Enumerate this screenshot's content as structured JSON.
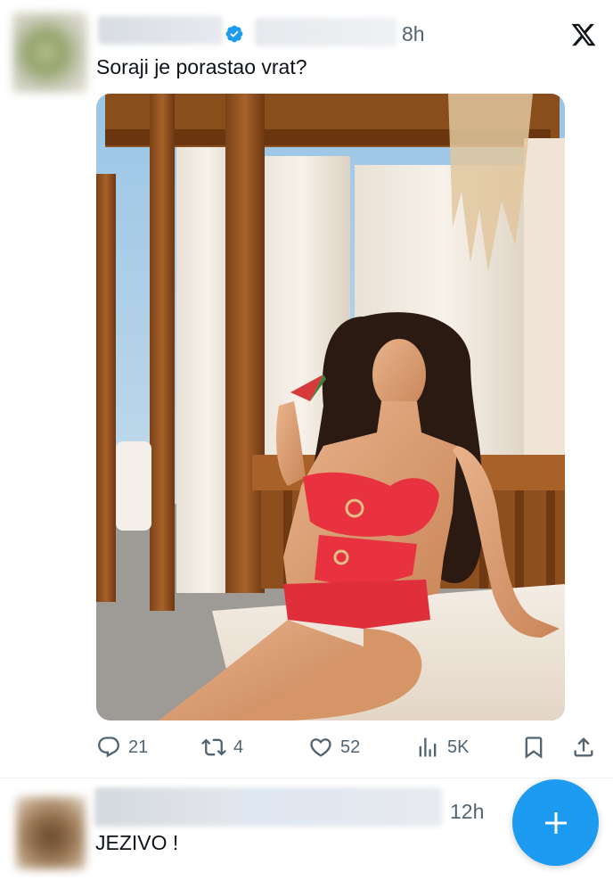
{
  "tweets": [
    {
      "time": "8h",
      "text": "Soraji je porastao vrat?",
      "stats": {
        "replies": "21",
        "retweets": "4",
        "likes": "52",
        "views": "5K"
      }
    },
    {
      "time": "12h",
      "text": "JEZIVO !"
    }
  ],
  "colors": {
    "accent": "#1d9bf0",
    "text": "#0f1419",
    "secondary": "#536471",
    "divider": "#eff3f4"
  },
  "icons": [
    "verified-badge-icon",
    "x-logo-icon",
    "reply-icon",
    "retweet-icon",
    "like-icon",
    "views-icon",
    "bookmark-icon",
    "share-icon",
    "compose-plus-icon"
  ]
}
